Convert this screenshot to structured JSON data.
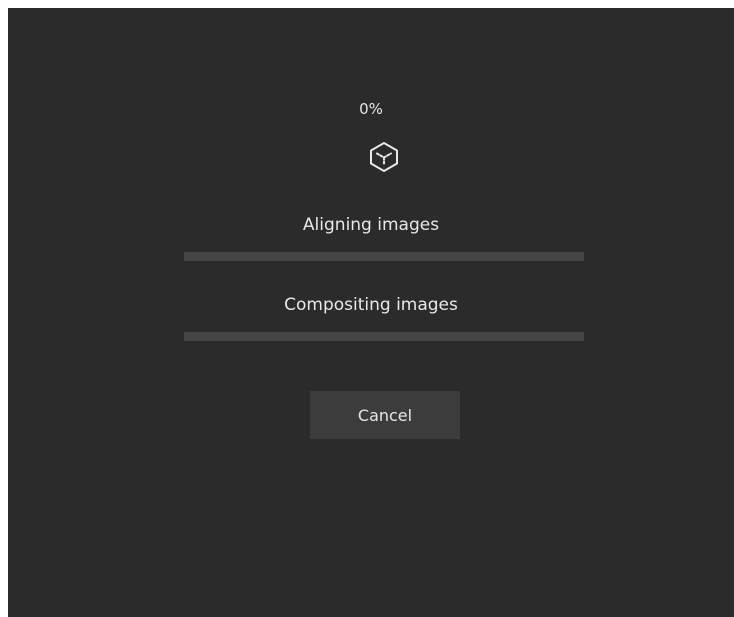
{
  "progress": {
    "percent_text": "0%",
    "overall_fraction": 0
  },
  "icon": "cube-icon",
  "tasks": [
    {
      "label": "Aligning images",
      "progress": 0
    },
    {
      "label": "Compositing images",
      "progress": 0
    }
  ],
  "buttons": {
    "cancel_label": "Cancel"
  },
  "colors": {
    "background": "#2b2b2b",
    "bar_track": "#464646",
    "text": "#e8e8e8",
    "button": "#3c3c3c"
  }
}
